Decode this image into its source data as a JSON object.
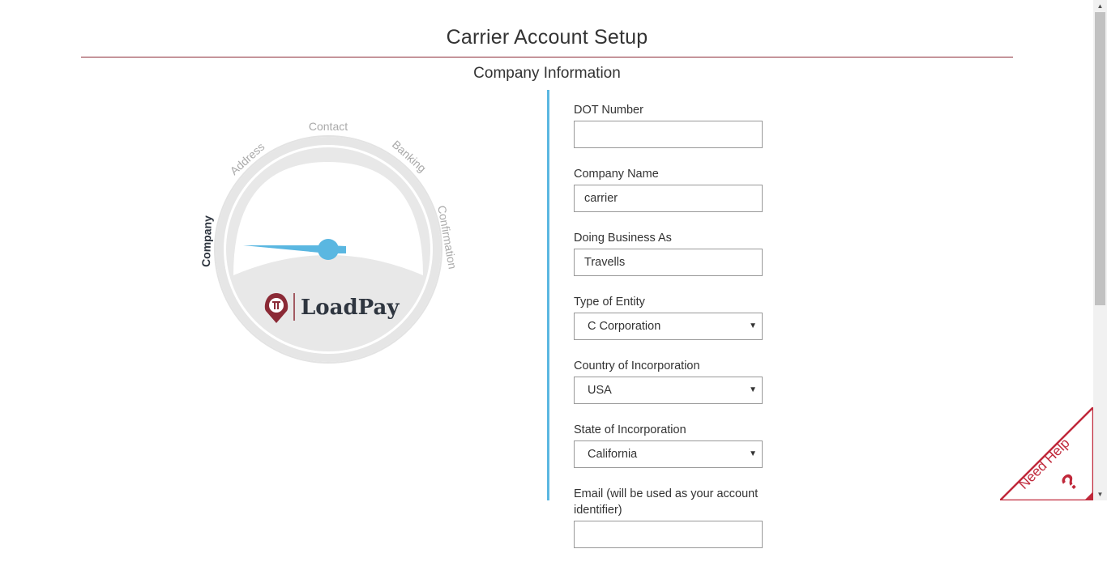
{
  "header": {
    "title": "Carrier Account Setup",
    "section": "Company Information"
  },
  "gauge": {
    "steps": [
      "Company",
      "Address",
      "Contact",
      "Banking",
      "Confirmation"
    ],
    "active_step": "Company",
    "logo_text": "LoadPay"
  },
  "form": {
    "dot_number": {
      "label": "DOT Number",
      "value": ""
    },
    "company_name": {
      "label": "Company Name",
      "value": "carrier"
    },
    "dba": {
      "label": "Doing Business As",
      "value": "Travells"
    },
    "entity_type": {
      "label": "Type of Entity",
      "value": "C Corporation"
    },
    "country": {
      "label": "Country of Incorporation",
      "value": "USA"
    },
    "state": {
      "label": "State of Incorporation",
      "value": "California"
    },
    "email": {
      "label": "Email (will be used as your account identifier)",
      "value": ""
    }
  },
  "help": {
    "label": "Need Help",
    "symbol": "?"
  },
  "colors": {
    "accent": "#5ab7e1",
    "brand": "#8b2a36",
    "text": "#333333"
  }
}
